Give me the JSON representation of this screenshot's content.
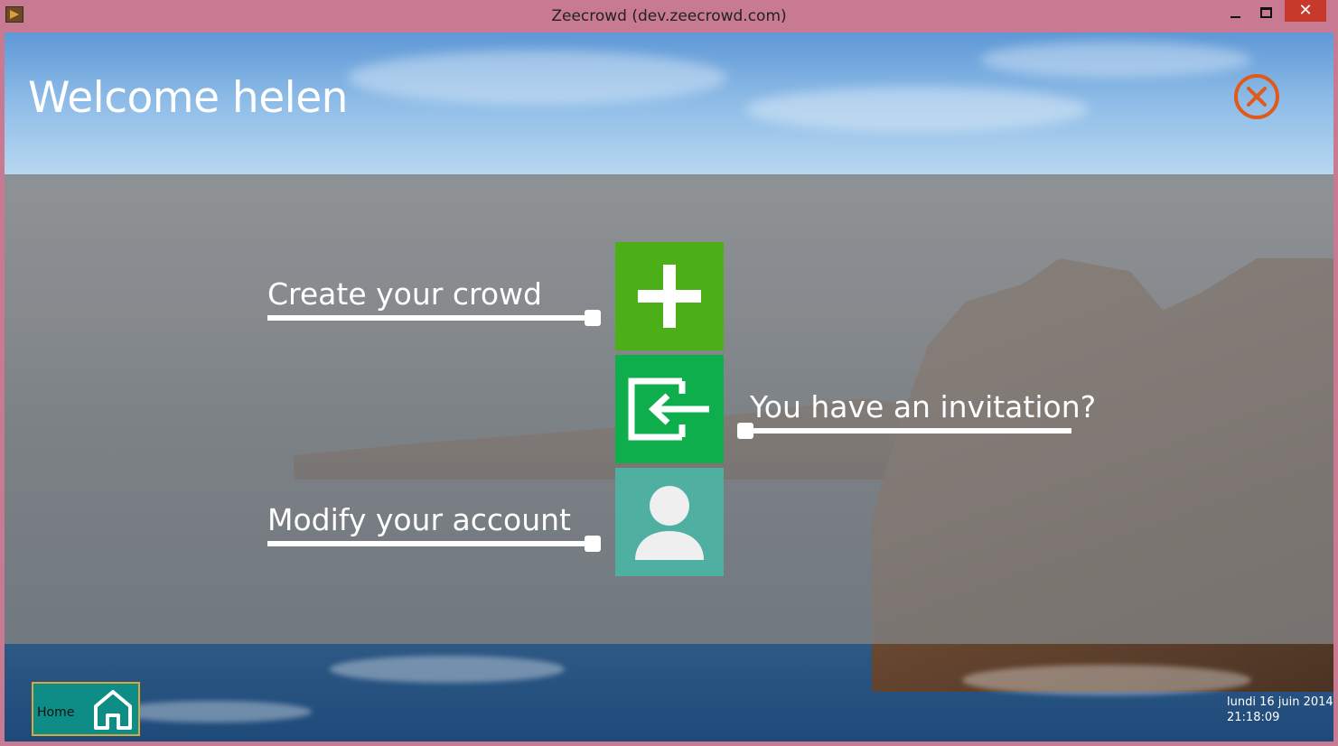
{
  "window": {
    "title": "Zeecrowd (dev.zeecrowd.com)",
    "close_glyph": "✕"
  },
  "header": {
    "title": "Welcome helen",
    "close_icon": "close-circle-icon",
    "close_color": "#e05a1c"
  },
  "actions": [
    {
      "label": "Create your crowd",
      "icon": "plus-icon",
      "color": "#4caf17"
    },
    {
      "label": "You have an invitation?",
      "icon": "enter-icon",
      "color": "#0fae4c"
    },
    {
      "label": "Modify your account",
      "icon": "user-icon",
      "color": "#4fb0a2"
    }
  ],
  "footer": {
    "home_label": "Home",
    "home_icon": "home-icon",
    "date": "lundi 16 juin 2014",
    "time": "21:18:09"
  }
}
